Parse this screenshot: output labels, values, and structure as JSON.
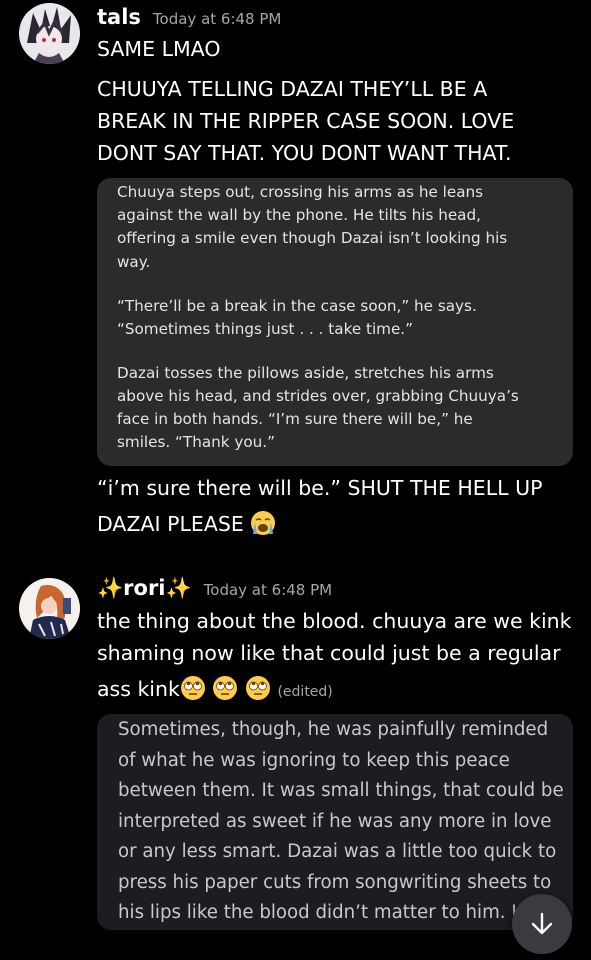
{
  "messages": [
    {
      "username": "tals",
      "timestamp": "Today at 6:48 PM",
      "lines": [
        "SAME LMAO",
        "CHUUYA TELLING DAZAI THEY’LL BE A",
        "BREAK IN THE RIPPER CASE SOON. LOVE",
        "DONT SAY THAT. YOU DONT WANT THAT."
      ],
      "quote_lines": [
        "Chuuya steps out, crossing his arms as he leans",
        "against the wall by the phone. He tilts his head,",
        "offering a smile even though Dazai isn’t looking his",
        "way.",
        "",
        "“There’ll be a break in the case soon,” he says.",
        "“Sometimes things just . . . take time.”",
        "",
        "Dazai tosses the pillows aside, stretches his arms",
        "above his head, and strides over, grabbing Chuuya’s",
        "face in both hands. “I’m sure there will be,” he",
        "smiles. “Thank you.”"
      ],
      "after_lines": [
        "“i’m sure there will be.” SHUT THE HELL UP",
        "DAZAI PLEASE"
      ],
      "after_emoji": "loudly-crying-face"
    },
    {
      "username_sparkle_left": "✨",
      "username": "rori",
      "username_sparkle_right": "✨",
      "timestamp": "Today at 6:48 PM",
      "lines": [
        "the thing about the blood. chuuya are we kink",
        "shaming now like that could just be a regular",
        "ass kink"
      ],
      "emojis": [
        "face-with-rolling-eyes",
        "face-with-rolling-eyes",
        "face-with-rolling-eyes"
      ],
      "edited": "(edited)",
      "image_text_lines": [
        "Sometimes, though, he was painfully reminded",
        "of what he was ignoring to keep this peace",
        "between them. It was small things, that could be",
        "interpreted as sweet if he was any more in love",
        "or any less smart. Dazai was a little too quick to",
        "press his paper cuts from songwriting sheets to",
        "his lips like the blood didn’t matter to him. He"
      ]
    }
  ],
  "scroll_button_icon": "arrow-down-icon",
  "colors": {
    "background": "#000000",
    "quote_bg": "#2b2b2e",
    "timestamp": "#a3a6aa"
  }
}
